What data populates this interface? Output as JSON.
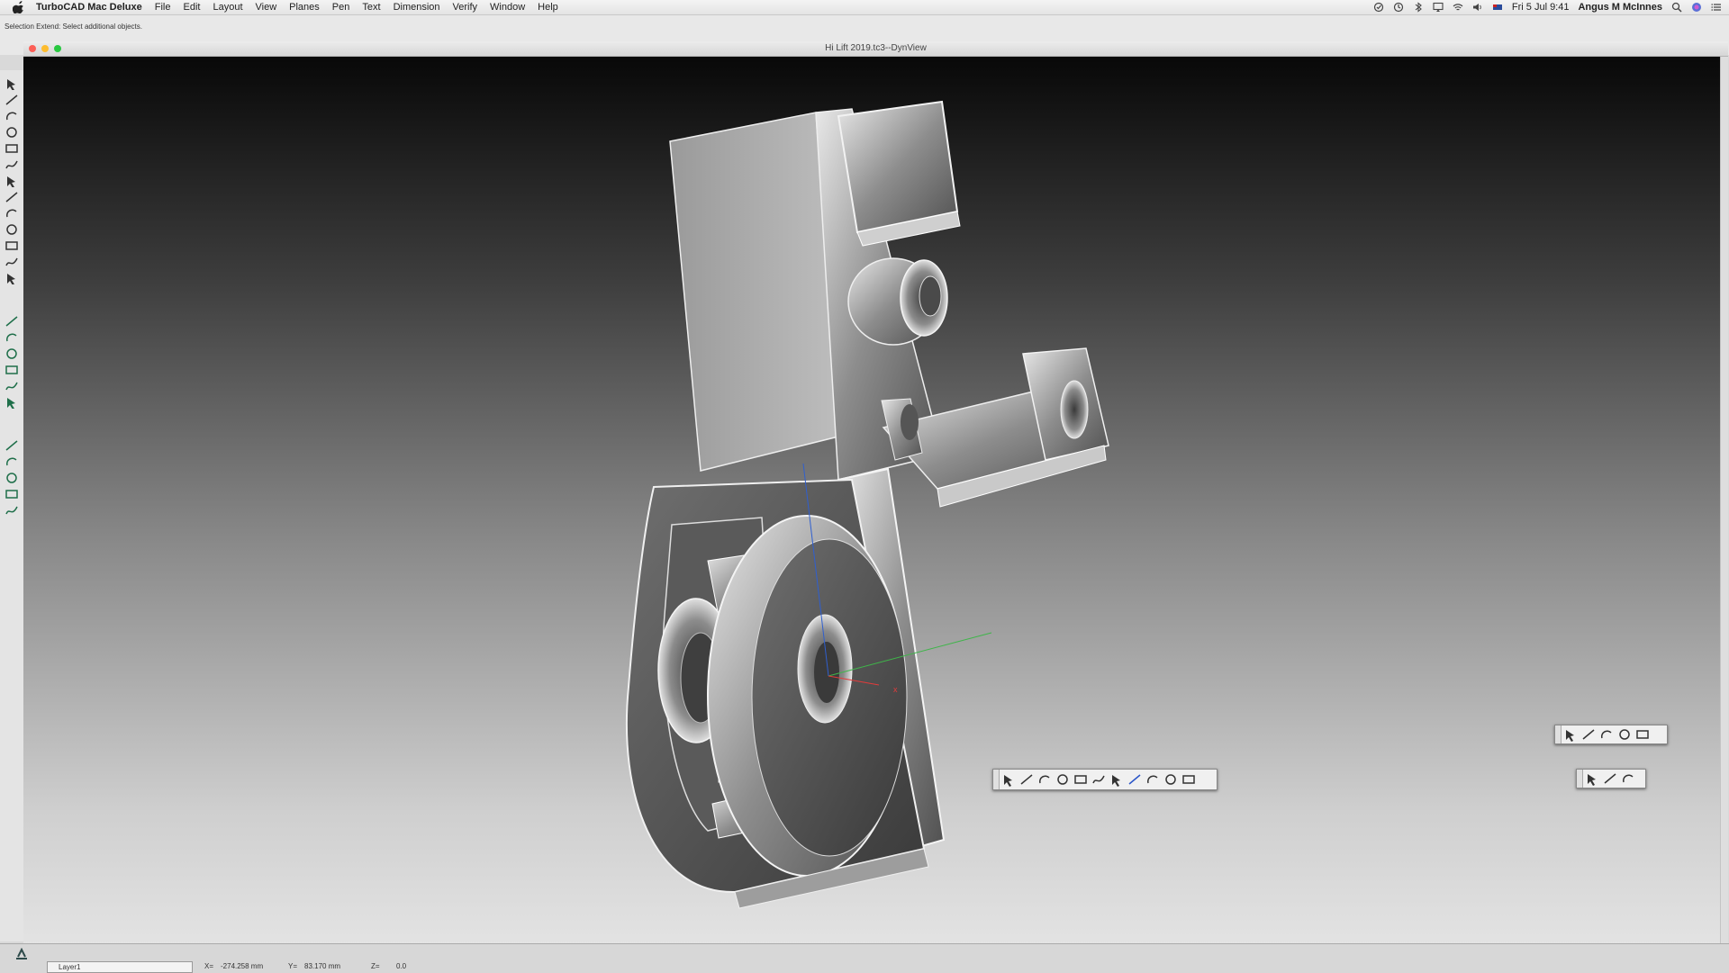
{
  "menubar": {
    "app_name": "TurboCAD Mac Deluxe",
    "items": [
      "File",
      "Edit",
      "Layout",
      "View",
      "Planes",
      "Pen",
      "Text",
      "Dimension",
      "Verify",
      "Window",
      "Help"
    ],
    "datetime": "Fri 5 Jul  9:41",
    "user": "Angus M McInnes"
  },
  "status": {
    "prompt": "Selection Extend: Select additional objects."
  },
  "window": {
    "title": "Hi Lift 2019.tc3--DynView"
  },
  "bottom": {
    "layer": "Layer1",
    "x_label": "X=",
    "x_value": "-274.258 mm",
    "y_label": "Y=",
    "y_value": "83.170 mm",
    "z_label": "Z=",
    "z_value": "0.0"
  },
  "toolbars": {
    "left_tools": [
      "select-icon",
      "line-icon",
      "arc-icon",
      "circle-icon",
      "ellipse-icon",
      "rectangle-icon",
      "curve-icon",
      "text-icon",
      "auto-dimension-icon",
      "fillet-icon",
      "trim-icon",
      "extend-icon",
      "transform-icon",
      "box-3d-icon",
      "extrude-icon",
      "revolve-icon",
      "sweep-icon",
      "loft-icon",
      "boolean-icon",
      "section-icon",
      "face-icon",
      "solid-edit-icon",
      "render-icon",
      "material-icon"
    ],
    "view_tools": [
      "zoom-icon",
      "pan-icon",
      "move-icon",
      "orbit-icon",
      "view-cube-icon",
      "view-iso-icon",
      "view-front-icon",
      "shaded-icon",
      "materials-icon",
      "wireframe-icon",
      "perspective-icon"
    ],
    "snap_tools": [
      "snap-line-icon",
      "snap-line2-icon",
      "snap-zigzag-icon",
      "snap-angle-icon",
      "snap-grid-icon"
    ],
    "select_tools": [
      "pointer-icon",
      "pick-icon",
      "select-edit-icon"
    ]
  },
  "colors": {
    "axis_x": "#e23b3b",
    "axis_y": "#3fb54a",
    "axis_z": "#2f5fd0"
  }
}
